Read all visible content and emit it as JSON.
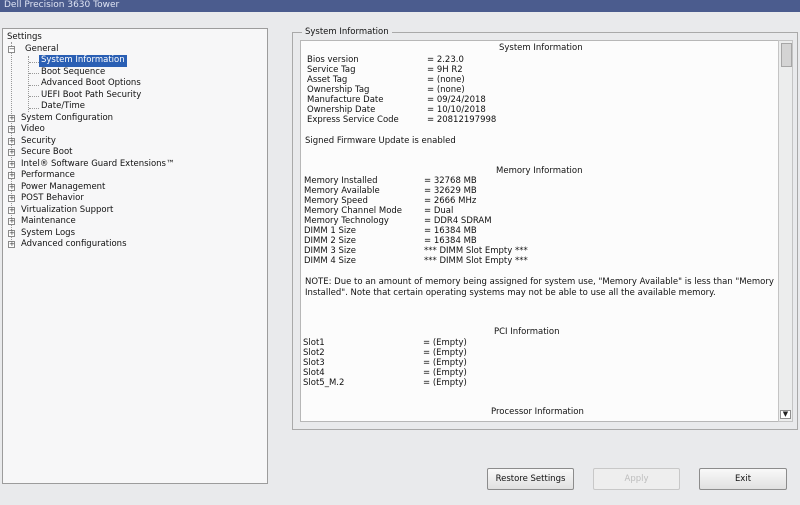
{
  "window": {
    "title": "Dell Precision 3630 Tower"
  },
  "settings_tree": {
    "root": "Settings",
    "general": {
      "label": "General",
      "children": [
        "System Information",
        "Boot Sequence",
        "Advanced Boot Options",
        "UEFI Boot Path Security",
        "Date/Time"
      ]
    },
    "groups": [
      "System Configuration",
      "Video",
      "Security",
      "Secure Boot",
      "Intel® Software Guard Extensions™",
      "Performance",
      "Power Management",
      "POST Behavior",
      "Virtualization Support",
      "Maintenance",
      "System Logs",
      "Advanced configurations"
    ]
  },
  "panel": {
    "group_title": "System Information",
    "system_info": {
      "title": "System Information",
      "rows": [
        {
          "key": "Bios version",
          "value": "= 2.23.0"
        },
        {
          "key": "Service Tag",
          "value": "= 9H    R2"
        },
        {
          "key": "Asset Tag",
          "value": "= (none)"
        },
        {
          "key": "Ownership Tag",
          "value": "= (none)"
        },
        {
          "key": "Manufacture Date",
          "value": "= 09/24/2018"
        },
        {
          "key": "Ownership Date",
          "value": "= 10/10/2018"
        },
        {
          "key": "Express Service Code",
          "value": "= 20812197998"
        }
      ],
      "firmware_note": "Signed Firmware Update is enabled"
    },
    "memory_info": {
      "title": "Memory Information",
      "rows": [
        {
          "key": "Memory Installed",
          "value": "= 32768 MB"
        },
        {
          "key": "Memory Available",
          "value": "= 32629 MB"
        },
        {
          "key": "Memory Speed",
          "value": "= 2666 MHz"
        },
        {
          "key": "Memory Channel Mode",
          "value": "= Dual"
        },
        {
          "key": "Memory Technology",
          "value": "= DDR4 SDRAM"
        },
        {
          "key": "DIMM 1 Size",
          "value": "= 16384 MB"
        },
        {
          "key": "DIMM 2 Size",
          "value": "= 16384 MB"
        },
        {
          "key": "DIMM 3 Size",
          "value": "*** DIMM Slot Empty ***"
        },
        {
          "key": "DIMM 4 Size",
          "value": "*** DIMM Slot Empty ***"
        }
      ],
      "note": "NOTE: Due to an amount of memory being assigned for system use, \"Memory Available\" is less than \"Memory Installed\". Note that certain operating systems may not be able to use all the available memory."
    },
    "pci_info": {
      "title": "PCI Information",
      "rows": [
        {
          "key": "Slot1",
          "value": "= (Empty)"
        },
        {
          "key": "Slot2",
          "value": "= (Empty)"
        },
        {
          "key": "Slot3",
          "value": "= (Empty)"
        },
        {
          "key": "Slot4",
          "value": "= (Empty)"
        },
        {
          "key": "Slot5_M.2",
          "value": "= (Empty)"
        }
      ]
    },
    "processor_info": {
      "title": "Processor Information"
    }
  },
  "buttons": {
    "restore": "Restore Settings",
    "apply": "Apply",
    "exit": "Exit"
  },
  "icons": {
    "collapse": "minus-box-icon",
    "expand": "plus-box-icon",
    "scroll_down": "arrow-down-icon"
  }
}
